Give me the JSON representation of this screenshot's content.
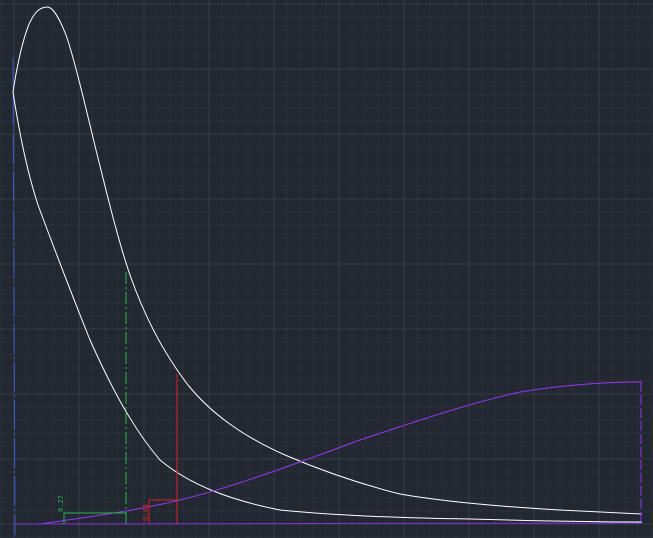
{
  "canvas": {
    "background_color": "#212830",
    "grid_minor_color": "#2a313b",
    "grid_major_color": "#343c47"
  },
  "entities": {
    "outer_curve": {
      "color": "#ffffff",
      "type": "polyline"
    },
    "inner_curve": {
      "color": "#ffffff",
      "type": "polyline"
    },
    "purple_curve": {
      "color": "#9b30ff",
      "type": "polyline"
    },
    "purple_baseline": {
      "color": "#8a2be2",
      "type": "line"
    },
    "y_axis": {
      "color": "#3a5bd6",
      "type": "line"
    },
    "green_dimension": {
      "color": "#20c040",
      "text": "0.27"
    },
    "red_dimension": {
      "color": "#e02020",
      "text": "0.48"
    }
  }
}
